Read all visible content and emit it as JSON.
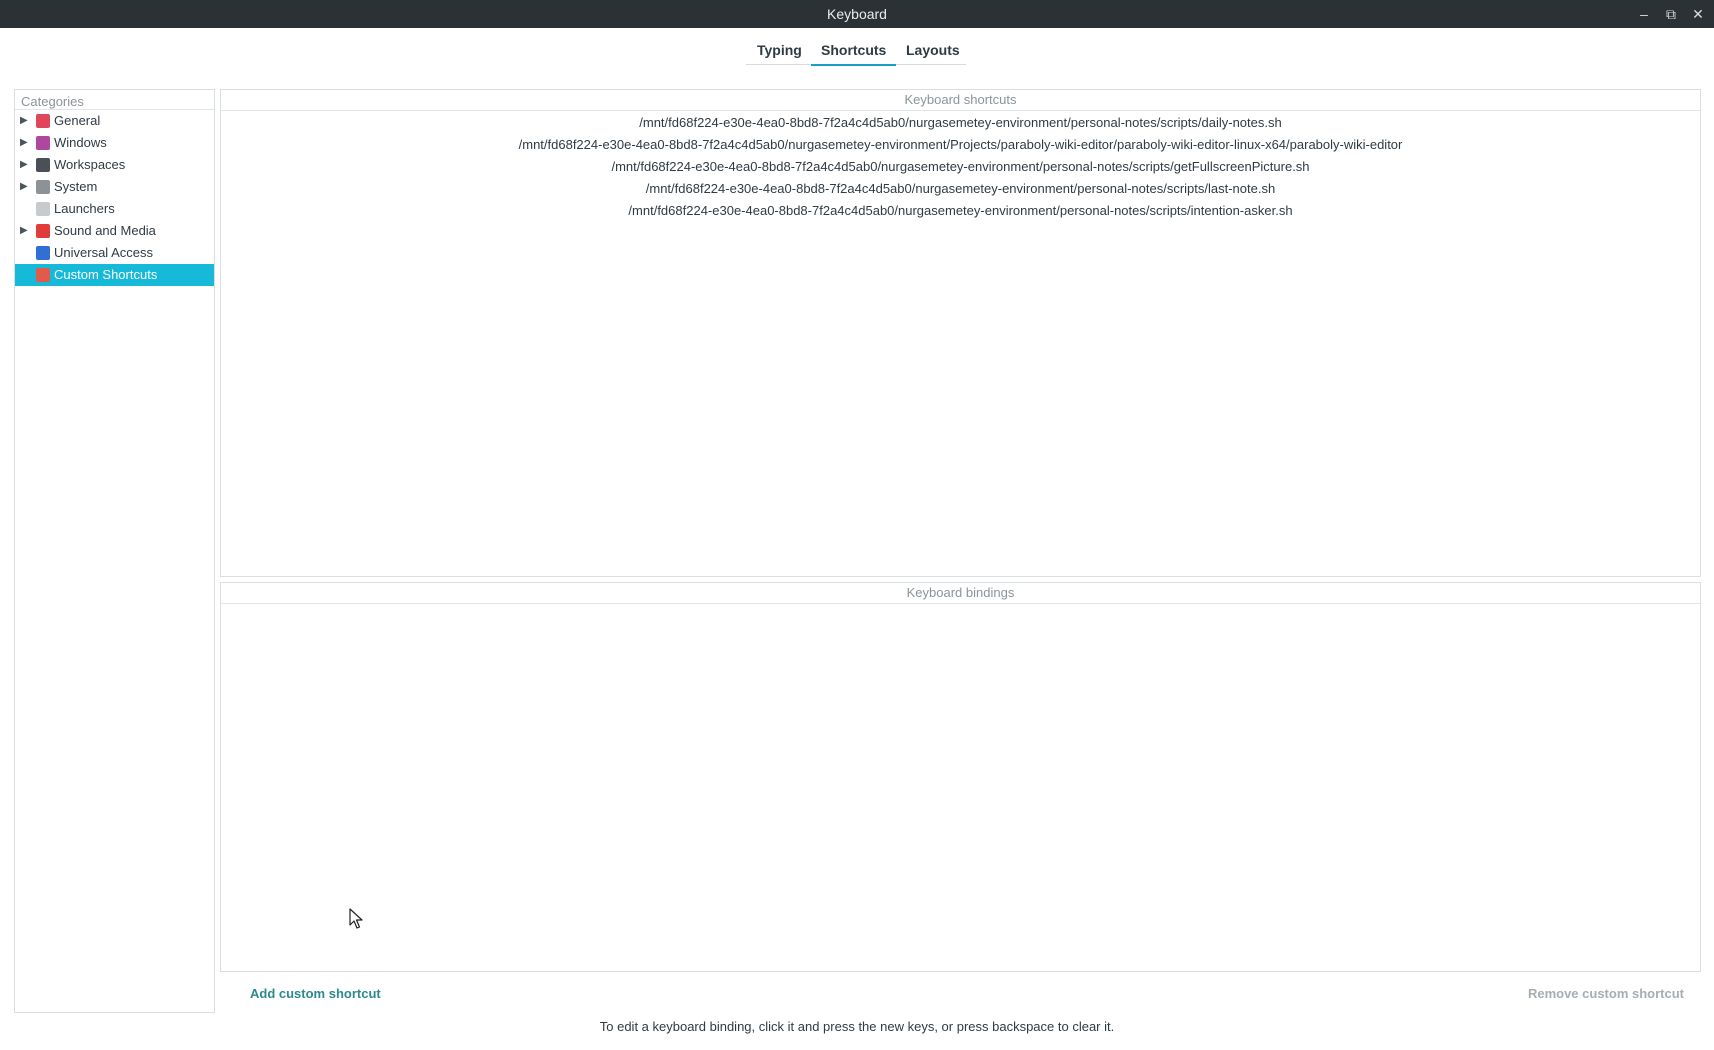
{
  "window": {
    "title": "Keyboard",
    "controls": {
      "minimize": "–",
      "maximize": "⧉",
      "close": "✕"
    }
  },
  "tabs": [
    {
      "label": "Typing",
      "active": false
    },
    {
      "label": "Shortcuts",
      "active": true
    },
    {
      "label": "Layouts",
      "active": false
    }
  ],
  "categories": {
    "header": "Categories",
    "items": [
      {
        "label": "General",
        "expandable": true,
        "icon": "general-icon",
        "color": "#e0455a"
      },
      {
        "label": "Windows",
        "expandable": true,
        "icon": "windows-icon",
        "color": "#b0479e"
      },
      {
        "label": "Workspaces",
        "expandable": true,
        "icon": "workspaces-icon",
        "color": "#4a5055"
      },
      {
        "label": "System",
        "expandable": true,
        "icon": "system-icon",
        "color": "#8c9296"
      },
      {
        "label": "Launchers",
        "expandable": false,
        "icon": "launchers-icon",
        "color": "#c7cbcd"
      },
      {
        "label": "Sound and Media",
        "expandable": true,
        "icon": "sound-media-icon",
        "color": "#e03c3c"
      },
      {
        "label": "Universal Access",
        "expandable": false,
        "icon": "universal-access-icon",
        "color": "#2f6fd6"
      },
      {
        "label": "Custom Shortcuts",
        "expandable": false,
        "icon": "custom-shortcuts-icon",
        "color": "#e25a4a",
        "selected": true
      }
    ]
  },
  "shortcuts": {
    "header": "Keyboard shortcuts",
    "rows": [
      "/mnt/fd68f224-e30e-4ea0-8bd8-7f2a4c4d5ab0/nurgasemetey-environment/personal-notes/scripts/daily-notes.sh",
      "/mnt/fd68f224-e30e-4ea0-8bd8-7f2a4c4d5ab0/nurgasemetey-environment/Projects/paraboly-wiki-editor/paraboly-wiki-editor-linux-x64/paraboly-wiki-editor",
      "/mnt/fd68f224-e30e-4ea0-8bd8-7f2a4c4d5ab0/nurgasemetey-environment/personal-notes/scripts/getFullscreenPicture.sh",
      "/mnt/fd68f224-e30e-4ea0-8bd8-7f2a4c4d5ab0/nurgasemetey-environment/personal-notes/scripts/last-note.sh",
      "/mnt/fd68f224-e30e-4ea0-8bd8-7f2a4c4d5ab0/nurgasemetey-environment/personal-notes/scripts/intention-asker.sh"
    ]
  },
  "bindings": {
    "header": "Keyboard bindings"
  },
  "actions": {
    "add": "Add custom shortcut",
    "remove": "Remove custom shortcut"
  },
  "hint": "To edit a keyboard binding, click it and press the new keys, or press backspace to clear it.",
  "colors": {
    "accent": "#16b9d8",
    "titlebar": "#2b3236"
  }
}
